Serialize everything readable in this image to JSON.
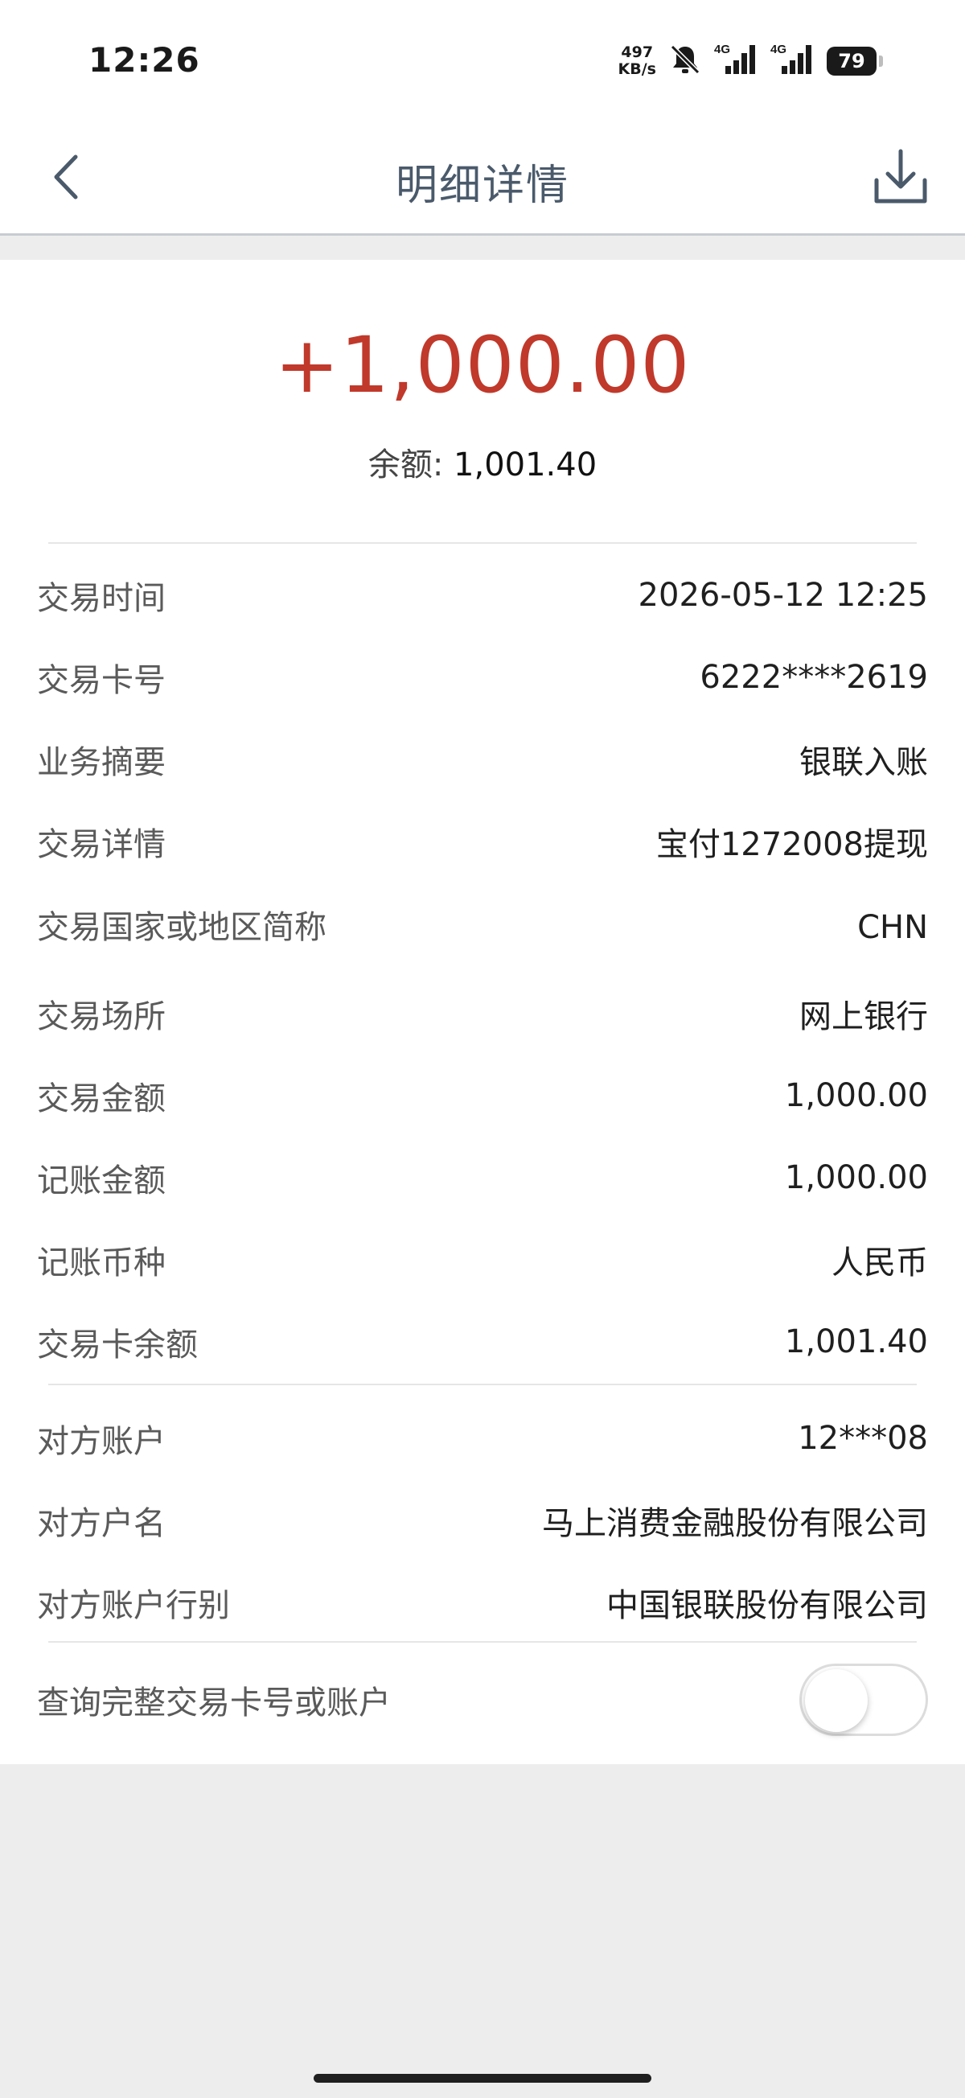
{
  "status_bar": {
    "time": "12:26",
    "net_speed_value": "497",
    "net_speed_unit": "KB/s",
    "signal1_label": "4G",
    "signal2_label": "4G",
    "battery": "79"
  },
  "header": {
    "title": "明细详情",
    "icons": [
      "back-arrow-icon",
      "download-icon"
    ]
  },
  "summary": {
    "amount": "+1,000.00",
    "balance_label": "余额: ",
    "balance_value": "1,001.40",
    "amount_color": "#c0392b"
  },
  "details": [
    {
      "label": "交易时间",
      "value": "2026-05-12 12:25"
    },
    {
      "label": "交易卡号",
      "value": "6222****2619"
    },
    {
      "label": "业务摘要",
      "value": "银联入账"
    },
    {
      "label": "交易详情",
      "value": "宝付1272008提现"
    },
    {
      "label": "交易国家或地区简称",
      "value": "CHN"
    },
    {
      "label": "交易场所",
      "value": "网上银行"
    },
    {
      "label": "交易金额",
      "value": "1,000.00"
    },
    {
      "label": "记账金额",
      "value": "1,000.00"
    },
    {
      "label": "记账币种",
      "value": "人民币"
    },
    {
      "label": "交易卡余额",
      "value": "1,001.40"
    }
  ],
  "counterparty": [
    {
      "label": "对方账户",
      "value": "12***08"
    },
    {
      "label": "对方户名",
      "value": "马上消费金融股份有限公司"
    },
    {
      "label": "对方账户行别",
      "value": "中国银联股份有限公司"
    }
  ],
  "toggle": {
    "label": "查询完整交易卡号或账户",
    "state": "off"
  }
}
